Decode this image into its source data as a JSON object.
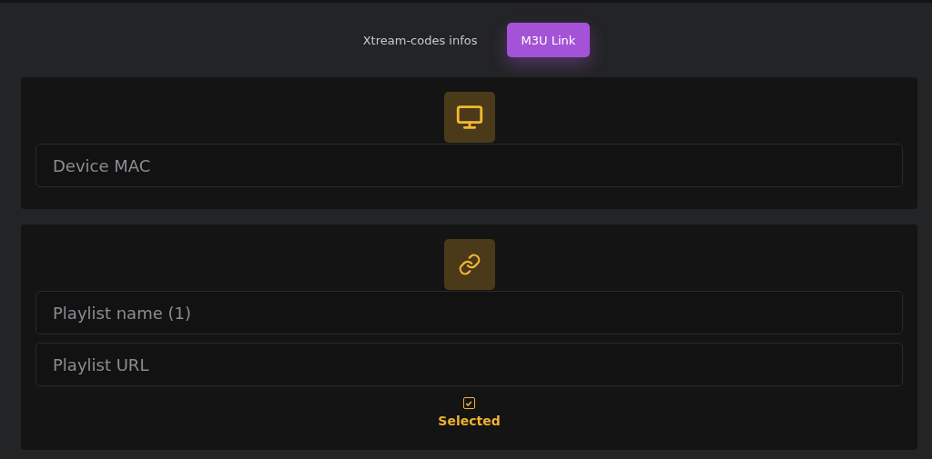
{
  "tabs": [
    {
      "label": "Xtream-codes infos",
      "selected": false
    },
    {
      "label": "M3U Link",
      "selected": true
    }
  ],
  "device_card": {
    "fields": [
      {
        "placeholder": "Device MAC"
      }
    ]
  },
  "playlist_card": {
    "fields": [
      {
        "placeholder": "Playlist name (1)"
      },
      {
        "placeholder": "Playlist URL"
      }
    ],
    "selected_toggle": {
      "label": "Selected",
      "checked": true
    }
  }
}
